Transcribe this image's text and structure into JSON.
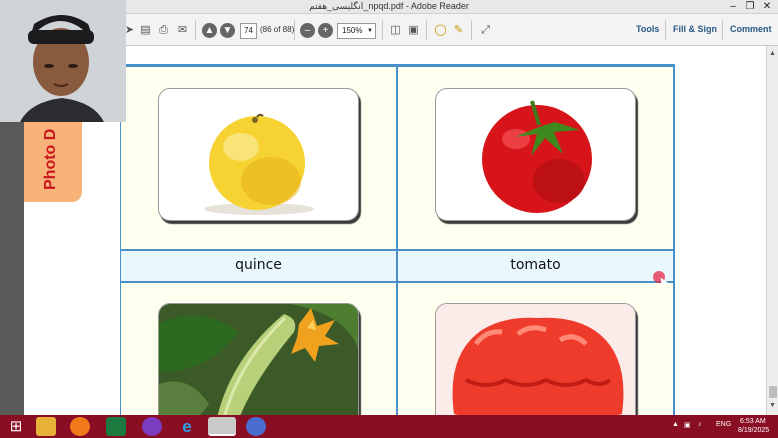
{
  "window": {
    "title": "انگلیسی_هفتم_npqd.pdf - Adobe Reader",
    "controls": [
      "minimize",
      "restore",
      "close"
    ]
  },
  "toolbar": {
    "page_input": "74",
    "page_of": "(86 of 88)",
    "zoom": "150%",
    "tools_label": "Tools",
    "fill_sign_label": "Fill & Sign",
    "comment_label": "Comment"
  },
  "sidebar": {
    "tab_label": "Photo D"
  },
  "document": {
    "cards": [
      {
        "label": "quince",
        "image": "quince-fruit"
      },
      {
        "label": "tomato",
        "image": "tomato-fruit"
      },
      {
        "label": "",
        "image": "zucchini-with-flower"
      },
      {
        "label": "",
        "image": "red-jelly"
      }
    ]
  },
  "taskbar": {
    "time": "6:53 AM",
    "date": "8/19/2025",
    "lang": "ENG",
    "apps": [
      "windows-start",
      "file-explorer",
      "firefox",
      "excel",
      "visual-studio",
      "internet-explorer",
      "windows-media-center",
      "screen-recorder"
    ]
  },
  "colors": {
    "grid_border": "#4a90c8",
    "label_bg": "#e9f8ff",
    "cell_bg": "#fffff0",
    "taskbar": "#8a0e23",
    "tab": "#f7b37a",
    "tab_text": "#c8161d"
  }
}
